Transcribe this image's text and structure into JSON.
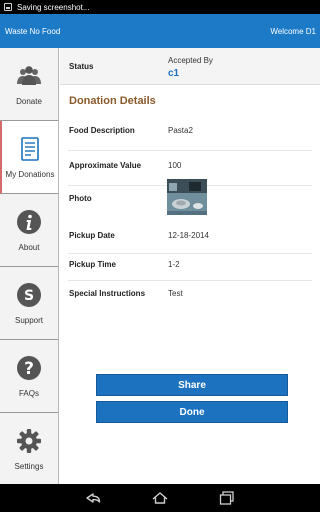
{
  "status_bar": {
    "notification": "Saving screenshot..."
  },
  "app_bar": {
    "title": "Waste No Food",
    "welcome": "Welcome D1"
  },
  "sidebar": {
    "items": [
      {
        "label": "Donate",
        "icon": "people-icon"
      },
      {
        "label": "My Donations",
        "icon": "document-icon",
        "active": true
      },
      {
        "label": "About",
        "icon": "info-icon"
      },
      {
        "label": "Support",
        "icon": "support-icon"
      },
      {
        "label": "FAQs",
        "icon": "question-icon"
      },
      {
        "label": "Settings",
        "icon": "gear-icon"
      }
    ]
  },
  "status": {
    "label": "Status",
    "accepted_label": "Accepted By",
    "accepted_value": "c1"
  },
  "details": {
    "title": "Donation Details",
    "food_description_label": "Food Description",
    "food_description": "Pasta2",
    "approximate_value_label": "Approximate Value",
    "approximate_value": "100",
    "photo_label": "Photo",
    "pickup_date_label": "Pickup Date",
    "pickup_date": "12-18-2014",
    "pickup_time_label": "Pickup Time",
    "pickup_time": "1-2",
    "special_instructions_label": "Special Instructions",
    "special_instructions": "Test"
  },
  "actions": {
    "share_label": "Share",
    "done_label": "Done"
  },
  "colors": {
    "accent": "#1d7ac7",
    "button": "#1d72bf",
    "section_title": "#8a5a2b",
    "active_indicator": "#d36b6b"
  }
}
